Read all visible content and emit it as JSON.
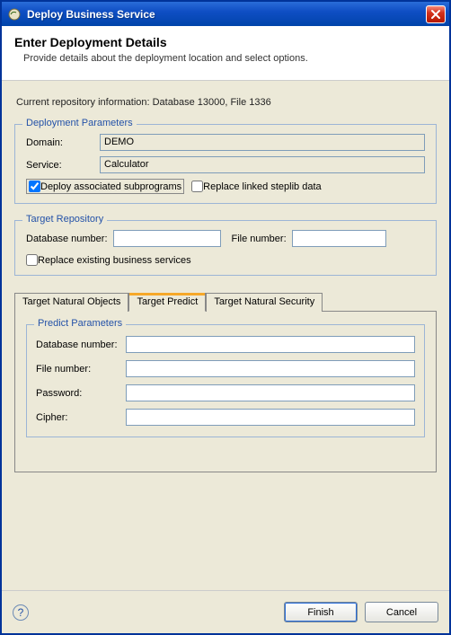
{
  "window": {
    "title": "Deploy Business Service",
    "close_icon": "close-icon"
  },
  "banner": {
    "heading": "Enter Deployment Details",
    "description": "Provide details about the deployment location and select options."
  },
  "repo_info": "Current repository information: Database 13000, File 1336",
  "deployment": {
    "legend": "Deployment Parameters",
    "domain_label": "Domain:",
    "domain_value": "DEMO",
    "service_label": "Service:",
    "service_value": "Calculator",
    "deploy_assoc_label": "Deploy associated subprograms",
    "deploy_assoc_checked": true,
    "replace_steplib_label": "Replace linked steplib data",
    "replace_steplib_checked": false
  },
  "target_repo": {
    "legend": "Target Repository",
    "db_label": "Database number:",
    "db_value": "",
    "file_label": "File number:",
    "file_value": "",
    "replace_existing_label": "Replace existing business services",
    "replace_existing_checked": false
  },
  "tabs": {
    "items": [
      {
        "label": "Target Natural Objects",
        "active": false
      },
      {
        "label": "Target Predict",
        "active": true
      },
      {
        "label": "Target Natural Security",
        "active": false
      }
    ]
  },
  "predict": {
    "legend": "Predict Parameters",
    "db_label": "Database number:",
    "db_value": "",
    "file_label": "File number:",
    "file_value": "",
    "pw_label": "Password:",
    "pw_value": "",
    "cipher_label": "Cipher:",
    "cipher_value": ""
  },
  "footer": {
    "finish_label": "Finish",
    "cancel_label": "Cancel"
  }
}
